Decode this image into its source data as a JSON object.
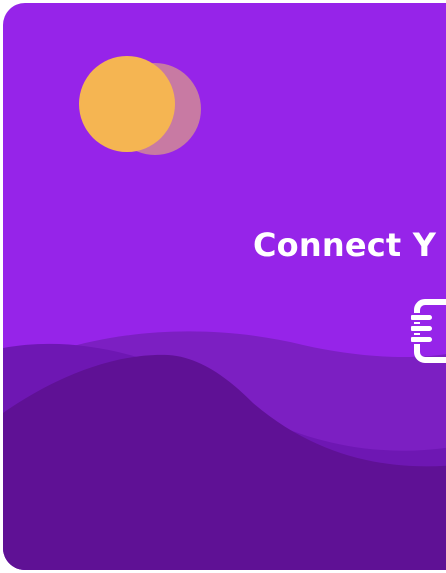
{
  "hero": {
    "headline": "Connect Y",
    "illustration_icons": [
      "sun-icon",
      "sun-shadow-icon",
      "hills-icon"
    ],
    "app_icon": "hand-icon"
  },
  "colors": {
    "sky": "#9624e9",
    "sun": "#f5b552",
    "sun_shadow": "#c87aa3",
    "hill_back": "#7c1fc2",
    "hill_mid": "#6e17b3",
    "hill_front": "#5f1195",
    "text": "#ffffff"
  }
}
